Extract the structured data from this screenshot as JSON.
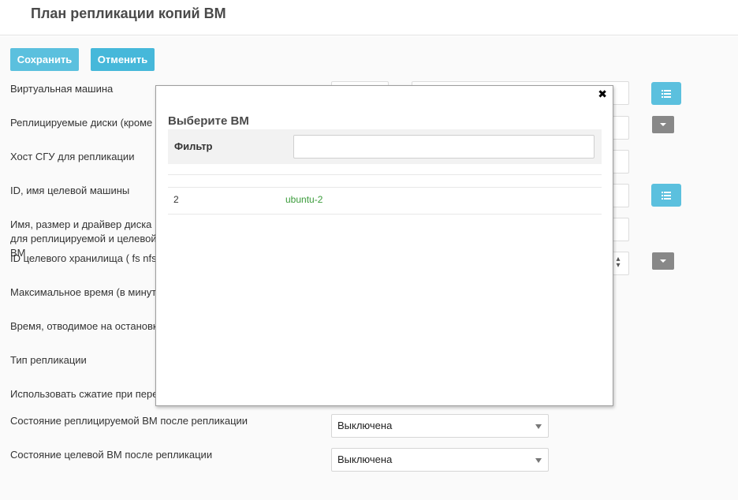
{
  "page": {
    "title": "План репликации копий ВМ"
  },
  "toolbar": {
    "save_label": "Сохранить",
    "cancel_label": "Отменить"
  },
  "form": {
    "labels": [
      "Виртуальная машина",
      "Реплицируемые диски (кроме C",
      "Хост СГУ для репликации",
      "ID, имя целевой машины",
      "Имя, размер и драйвер диска для реплицируемой и целевой ВМ",
      "ID целевого хранилища ( fs nfs s",
      "Максимальное время (в минутах",
      "Время, отводимое на остановку",
      "Тип репликации",
      "Использовать сжатие при перед",
      "Состояние реплицируемой ВМ после репликации",
      "Состояние целевой ВМ после репликации"
    ],
    "source_vm_state": {
      "value": "Выключена"
    },
    "target_vm_state": {
      "value": "Выключена"
    }
  },
  "icons": {
    "list_button": "list-icon",
    "dropdown_button": "caret-down-icon",
    "close": "close-icon"
  },
  "modal": {
    "close_label": "✖",
    "title": "Выберите ВМ",
    "filter_label": "Фильтр",
    "filter_value": "",
    "rows": [
      {
        "id": "2",
        "name": "ubuntu-2"
      }
    ]
  },
  "colors": {
    "primary_button": "#5bc0de",
    "secondary_button": "#888888",
    "link_green": "#3a9b3a"
  }
}
